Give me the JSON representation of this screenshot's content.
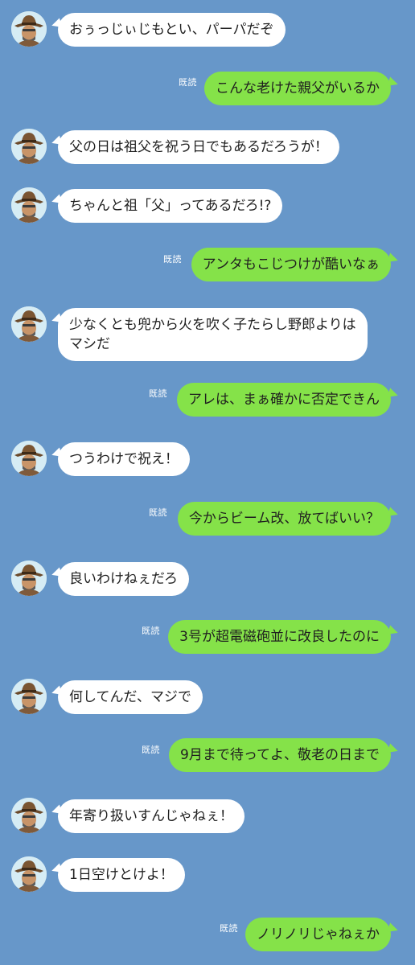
{
  "colors": {
    "background": "#6797c9",
    "incoming_bubble": "#ffffff",
    "outgoing_bubble": "#85e249"
  },
  "read_label": "既読",
  "messages": [
    {
      "side": "in",
      "text": "おぅっじぃじもとい、パーパだぞ"
    },
    {
      "side": "out",
      "text": "こんな老けた親父がいるか"
    },
    {
      "side": "in",
      "text": "父の日は祖父を祝う日でもあるだろうが！"
    },
    {
      "side": "in",
      "text": "ちゃんと祖「父」ってあるだろ!?"
    },
    {
      "side": "out",
      "text": "アンタもこじつけが酷いなぁ"
    },
    {
      "side": "in",
      "text": "少なくとも兜から火を吹く子たらし野郎よりは\nマシだ"
    },
    {
      "side": "out",
      "text": "アレは、まぁ確かに否定できん"
    },
    {
      "side": "in",
      "text": "つうわけで祝え！"
    },
    {
      "side": "out",
      "text": "今からビーム改、放てばいい？"
    },
    {
      "side": "in",
      "text": "良いわけねぇだろ"
    },
    {
      "side": "out",
      "text": "3号が超電磁砲並に改良したのに"
    },
    {
      "side": "in",
      "text": "何してんだ、マジで"
    },
    {
      "side": "out",
      "text": "9月まで待ってよ、敬老の日まで"
    },
    {
      "side": "in",
      "text": "年寄り扱いすんじゃねぇ！"
    },
    {
      "side": "in",
      "text": "1日空けとけよ！"
    },
    {
      "side": "out",
      "text": "ノリノリじゃねぇか"
    }
  ]
}
